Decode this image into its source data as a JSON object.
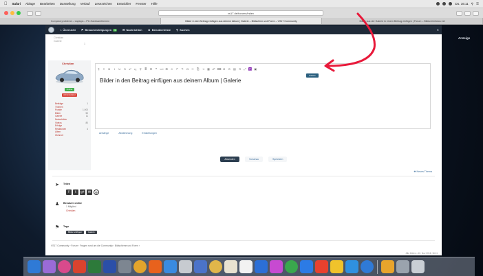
{
  "menubar": {
    "app": "Safari",
    "items": [
      "Ablage",
      "Bearbeiten",
      "Darstellung",
      "Verlauf",
      "Lesezeichen",
      "Entwickler",
      "Fenster",
      "Hilfe"
    ],
    "clock": "Do. 16:11"
  },
  "browser": {
    "url": "vs17.de/forums/index",
    "tabs": [
      "Computerprobleme – Laptops – PC-Hardwarethemen",
      "Bilder in den Beitrag einfügen aus deinem Album | Galerie – Bildschirm und Foren – VS17 Community",
      "Bilder aus der Galerie in einem Beitrag einfügen | Forum – Bildschirmfotos mit"
    ]
  },
  "sitenav": {
    "items": [
      "Übersicht",
      "Benachrichtigungen",
      "Nachrichten",
      "Benutzerleiste",
      "Suchen"
    ],
    "badge": "1"
  },
  "right_panel": {
    "label": "Anzeige"
  },
  "prevpost": {
    "lines": [
      "Christian",
      "Galerie"
    ],
    "side": "1"
  },
  "author": {
    "name": "Christian",
    "badge_green": "Online",
    "badge_red": "Administrator",
    "stats": [
      {
        "label": "Beiträge",
        "value": "1"
      },
      {
        "label": "Themen",
        "value": ""
      },
      {
        "label": "Punkte",
        "value": "1.000"
      },
      {
        "label": "Bilder",
        "value": "50"
      },
      {
        "label": "Galerie",
        "value": "11"
      },
      {
        "label": "Nutzerbilder",
        "value": ""
      },
      {
        "label": "Videos",
        "value": "80"
      },
      {
        "label": "Erfolge",
        "value": ""
      },
      {
        "label": "Reaktionen",
        "value": "4"
      },
      {
        "label": "Alben",
        "value": ""
      },
      {
        "label": "Wohnort",
        "value": ""
      }
    ]
  },
  "editor": {
    "tools": [
      "¶",
      "≡",
      "B",
      "I",
      "U",
      "S",
      "x²",
      "x₂",
      "⚲",
      "≣",
      "☰",
      "❝",
      "</>",
      "⊞",
      "☺",
      "↶",
      "↷",
      "Ω",
      "✂",
      "⎘",
      "⇥",
      "▦",
      "☍",
      "⌨",
      "⊕",
      "⊖",
      "▤",
      "⟲",
      "⤢",
      "◫",
      "▣"
    ],
    "tooltip": "Galerie",
    "content": "Bilder in den Beitrag einfügen aus deinem Album | Galerie",
    "tabs": [
      "Anhänge",
      "Abstimmung",
      "Einstellungen"
    ]
  },
  "buttons": {
    "submit": "Absenden",
    "preview": "Vorschau",
    "save": "Speichern"
  },
  "new_topic": "Neues Thema",
  "share": {
    "title": "Teilen",
    "icons": [
      "f",
      "t",
      "g+",
      "✉",
      "⊕"
    ]
  },
  "readers": {
    "title": "Benutzer online",
    "subtitle": "1 Mitglied",
    "name": "Christian"
  },
  "tags": {
    "title": "Tags",
    "items": [
      "Bilder einfügen",
      "Galerie"
    ]
  },
  "breadcrumb": "VS17 Community  ›  Forum  ›  Fragen rund um die Community  ›  Bildschirme und Foren  ›",
  "footer_meta": "Alle Zeiten  •  10. Nov 2016, 16:11",
  "colors": {
    "accent": "#8b2fb4",
    "arrow": "#e8193a",
    "navbar": "#1f2a38"
  }
}
